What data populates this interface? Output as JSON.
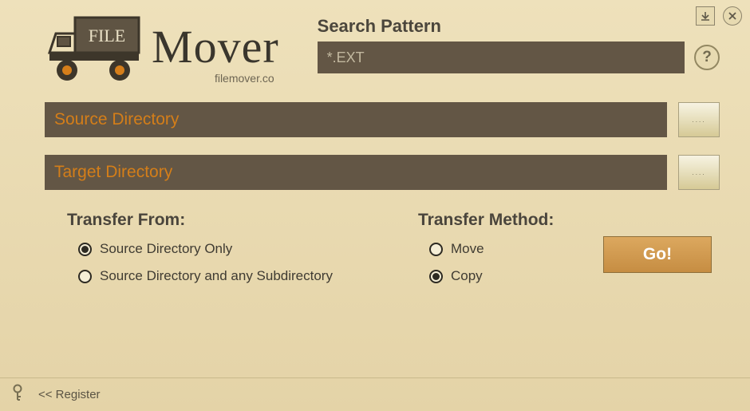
{
  "app": {
    "brand": "Mover",
    "file_word": "FILE",
    "url": "filemover.co"
  },
  "search_pattern": {
    "label": "Search Pattern",
    "value": "*.EXT",
    "help": "?"
  },
  "source_dir": {
    "placeholder": "Source Directory",
    "browse": "...."
  },
  "target_dir": {
    "placeholder": "Target Directory",
    "browse": "...."
  },
  "transfer_from": {
    "heading": "Transfer From:",
    "options": [
      {
        "label": "Source Directory Only",
        "checked": true
      },
      {
        "label": "Source Directory and any Subdirectory",
        "checked": false
      }
    ]
  },
  "transfer_method": {
    "heading": "Transfer Method:",
    "options": [
      {
        "label": "Move",
        "checked": false
      },
      {
        "label": "Copy",
        "checked": true
      }
    ]
  },
  "go_button": "Go!",
  "footer": {
    "register": "<< Register"
  }
}
